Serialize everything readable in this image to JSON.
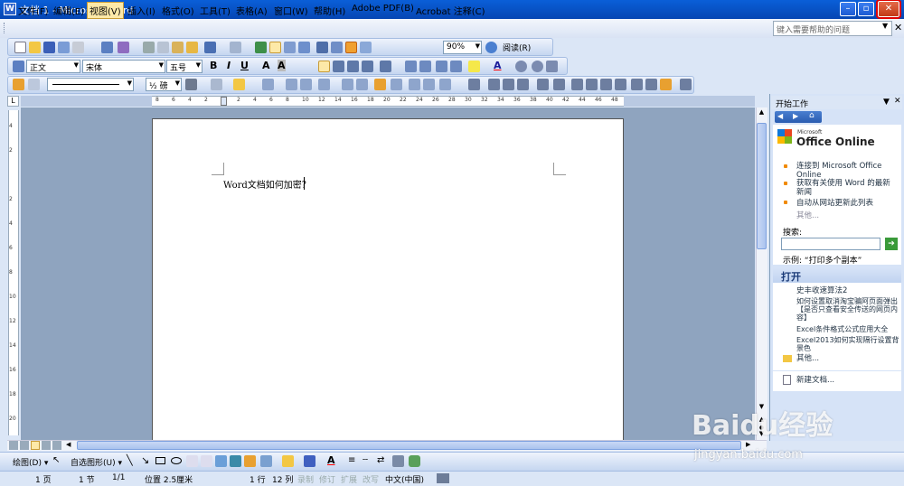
{
  "app": {
    "title": "文档 1 - Microsoft Word"
  },
  "menu": [
    "文件(F)",
    "编辑(E)",
    "视图(V)",
    "插入(I)",
    "格式(O)",
    "工具(T)",
    "表格(A)",
    "窗口(W)",
    "帮助(H)",
    "Adobe PDF(B)",
    "Acrobat 注释(C)"
  ],
  "help_placeholder": "键入需要帮助的问题",
  "toolbar": {
    "zoom": "90%",
    "read_label": "阅读(R)"
  },
  "format": {
    "style": "正文",
    "font": "宋体",
    "size": "五号",
    "bold": "B",
    "italic": "I",
    "underline": "U",
    "font_color": "A"
  },
  "table_bar": {
    "line_weight": "½ 磅"
  },
  "ruler": {
    "h_ticks": [
      "8",
      "6",
      "4",
      "2",
      "",
      "2",
      "4",
      "6",
      "8",
      "10",
      "12",
      "14",
      "16",
      "18",
      "20",
      "22",
      "24",
      "26",
      "28",
      "30",
      "32",
      "34",
      "36",
      "38",
      "40",
      "42",
      "44",
      "46",
      "48"
    ],
    "v_ticks": [
      "4",
      "2",
      "",
      "2",
      "4",
      "6",
      "8",
      "10",
      "12",
      "14",
      "16",
      "18",
      "20"
    ]
  },
  "document": {
    "text": "Word文档如何加密？"
  },
  "task_pane": {
    "title": "开始工作",
    "office_small": "Microsoft",
    "office_logo": "Office Online",
    "links": [
      "连接到 Microsoft Office Online",
      "获取有关使用 Word 的最新新闻",
      "自动从网站更新此列表"
    ],
    "more": "其他...",
    "search_label": "搜索:",
    "example_label": "示例:",
    "example_text": "“打印多个副本”",
    "open_title": "打开",
    "recent": [
      "史丰收速算法2",
      "如何设置取消淘宝骗阿页面弹出【是否只查看安全传送的网页内容】",
      "Excel条件格式公式应用大全",
      "Excel2013如何实现隔行设置背景色"
    ],
    "open_more": "其他...",
    "new_doc": "新建文档..."
  },
  "drawbar": {
    "draw_label": "绘图(D)",
    "autoshape_label": "自选图形(U)"
  },
  "status": {
    "page": "1 页",
    "section": "1 节",
    "pages": "1/1",
    "position": "位置 2.5厘米",
    "line": "1 行",
    "col": "12 列",
    "rec": "录制",
    "trk": "修订",
    "ext": "扩展",
    "ovr": "改写",
    "lang": "中文(中国)"
  },
  "watermark": {
    "main": "Baidu经验",
    "url": "jingyan.baidu.com"
  },
  "colors": {
    "title": "#0a5fd8",
    "toolbar": "#c5d6f0",
    "close": "#c23a16",
    "highlight": "#fde9a8"
  }
}
